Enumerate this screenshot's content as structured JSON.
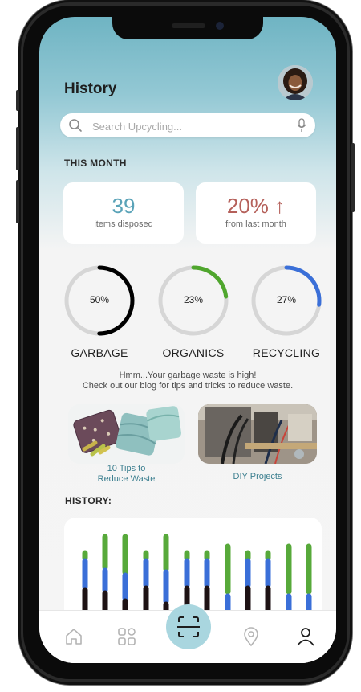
{
  "header": {
    "title": "History"
  },
  "search": {
    "placeholder": "Search Upcycling..."
  },
  "this_month": {
    "label": "THIS MONTH",
    "cards": [
      {
        "value": "39",
        "caption": "items disposed",
        "color": "#5aa3b8"
      },
      {
        "value": "20%",
        "arrow": "↑",
        "caption": "from last month",
        "color": "#b5605a"
      }
    ]
  },
  "rings": [
    {
      "percent": "50%",
      "label": "GARBAGE",
      "fraction": 0.5,
      "color": "#000000"
    },
    {
      "percent": "23%",
      "label": "ORGANICS",
      "fraction": 0.23,
      "color": "#4fa62d"
    },
    {
      "percent": "27%",
      "label": "RECYCLING",
      "fraction": 0.27,
      "color": "#3a6fd8"
    }
  ],
  "advice": {
    "line1": "Hmm...Your garbage waste is high!",
    "line2": "Check out our blog for tips and tricks to reduce waste."
  },
  "blog": [
    {
      "caption_line1": "10 Tips to",
      "caption_line2": "Reduce Waste"
    },
    {
      "caption_line1": "DIY Projects",
      "caption_line2": ""
    }
  ],
  "history": {
    "label": "HISTORY:",
    "colors": {
      "garbage": "#1e1214",
      "recycling": "#3a6fd8",
      "organics": "#57a93a"
    }
  },
  "tabs": [
    {
      "name": "home-icon"
    },
    {
      "name": "grid-icon"
    },
    {
      "name": "scan-icon"
    },
    {
      "name": "location-pin-icon"
    },
    {
      "name": "profile-icon"
    }
  ]
}
